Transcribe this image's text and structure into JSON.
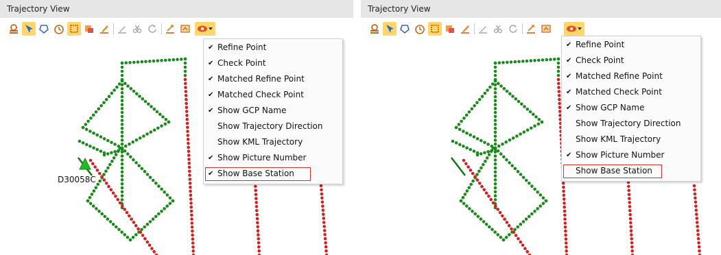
{
  "panels": [
    {
      "title": "Trajectory View",
      "gcp_name": "D30058C",
      "show_gcp_marker": true,
      "menu_items": [
        {
          "label": "Refine Point",
          "checked": true
        },
        {
          "label": "Check Point",
          "checked": true
        },
        {
          "label": "Matched Refine Point",
          "checked": true
        },
        {
          "label": "Matched Check Point",
          "checked": true
        },
        {
          "label": "Show GCP Name",
          "checked": true
        },
        {
          "label": "Show Trajectory Direction",
          "checked": false
        },
        {
          "label": "Show KML Trajectory",
          "checked": false
        },
        {
          "label": "Show Picture Number",
          "checked": true
        },
        {
          "label": "Show Base Station",
          "checked": true,
          "highlighted": true
        }
      ]
    },
    {
      "title": "Trajectory View",
      "gcp_name": "",
      "show_gcp_marker": false,
      "menu_items": [
        {
          "label": "Refine Point",
          "checked": true
        },
        {
          "label": "Check Point",
          "checked": true
        },
        {
          "label": "Matched Refine Point",
          "checked": true
        },
        {
          "label": "Matched Check Point",
          "checked": true
        },
        {
          "label": "Show GCP Name",
          "checked": true
        },
        {
          "label": "Show Trajectory Direction",
          "checked": false
        },
        {
          "label": "Show KML Trajectory",
          "checked": false
        },
        {
          "label": "Show Picture Number",
          "checked": true
        },
        {
          "label": "Show Base Station",
          "checked": false,
          "highlighted": true
        }
      ]
    }
  ],
  "check_mark": "✔",
  "toolbar_icons": [
    "layer-icon",
    "pointer-icon",
    "lasso-icon",
    "clock-icon",
    "select-rect-icon",
    "copy-layer-icon",
    "measure-icon",
    "edit-line-icon",
    "cut-icon",
    "refresh-icon",
    "export-icon",
    "map-icon",
    "eye-dropdown-icon"
  ],
  "colors": {
    "trajectory_green": "#1a8a1a",
    "trajectory_red": "#d42020",
    "active_tool": "#ffd66b",
    "highlight_box": "#d0312d",
    "title_bar": "#e6e6e6"
  }
}
